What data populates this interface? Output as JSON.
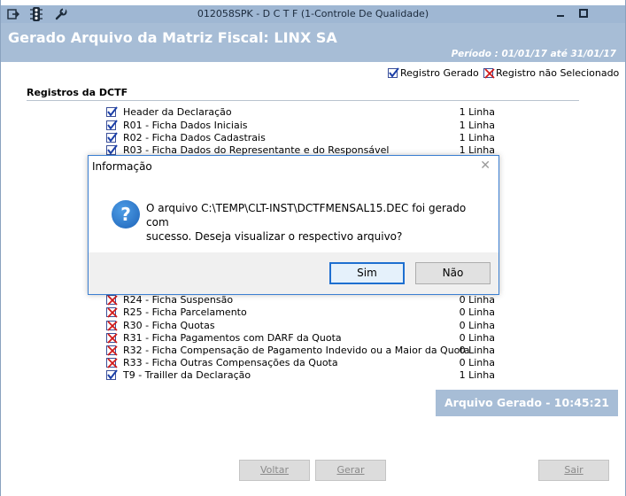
{
  "titlebar": {
    "title": "012058SPK - D C T F (1-Controle De Qualidade)",
    "icons": [
      "export-icon",
      "traffic-light-icon",
      "wrench-icon"
    ],
    "controls": [
      "minimize",
      "restore"
    ]
  },
  "header": {
    "title": "Gerado Arquivo da Matriz Fiscal: LINX SA",
    "period": "Período : 01/01/17 até 31/01/17"
  },
  "legend": {
    "generated": "Registro Gerado",
    "not_selected": "Registro não Selecionado"
  },
  "section": {
    "title": "Registros da DCTF"
  },
  "rows_top": [
    {
      "state": "checked",
      "label": "Header da Declaração",
      "count": "1 Linha"
    },
    {
      "state": "checked",
      "label": "R01 - Ficha Dados Iniciais",
      "count": "1 Linha"
    },
    {
      "state": "checked",
      "label": "R02 - Ficha Dados Cadastrais",
      "count": "1 Linha"
    },
    {
      "state": "checked",
      "label": "R03 - Ficha Dados do Representante e do Responsável",
      "count": "1 Linha"
    }
  ],
  "rows_bottom": [
    {
      "state": "unselected",
      "label": "R24 - Ficha Suspensão",
      "count": "0 Linha"
    },
    {
      "state": "unselected",
      "label": "R25 - Ficha Parcelamento",
      "count": "0 Linha"
    },
    {
      "state": "unselected",
      "label": "R30 - Ficha Quotas",
      "count": "0 Linha"
    },
    {
      "state": "unselected",
      "label": "R31 - Ficha Pagamentos com DARF da Quota",
      "count": "0 Linha"
    },
    {
      "state": "unselected",
      "label": "R32 - Ficha Compensação de Pagamento Indevido ou a Maior da Quota",
      "count": "0 Linha"
    },
    {
      "state": "unselected",
      "label": "R33 - Ficha Outras Compensações da Quota",
      "count": "0 Linha"
    },
    {
      "state": "checked",
      "label": "T9 - Trailler da Declaração",
      "count": "1 Linha"
    }
  ],
  "status": "Arquivo Gerado - 10:45:21",
  "buttons": {
    "voltar": "Voltar",
    "gerar": "Gerar",
    "sair": "Sair"
  },
  "dialog": {
    "title": "Informação",
    "message_line1": "O arquivo C:\\TEMP\\CLT-INST\\DCTFMENSAL15.DEC foi gerado com",
    "message_line2": "sucesso. Deseja visualizar o respectivo arquivo?",
    "yes": "Sim",
    "no": "Não",
    "close_glyph": "✕",
    "icon_glyph": "?"
  },
  "colors": {
    "accent": "#a7bdd6",
    "check_blue": "#1b3fa8",
    "cross_red": "#d11b1b"
  }
}
